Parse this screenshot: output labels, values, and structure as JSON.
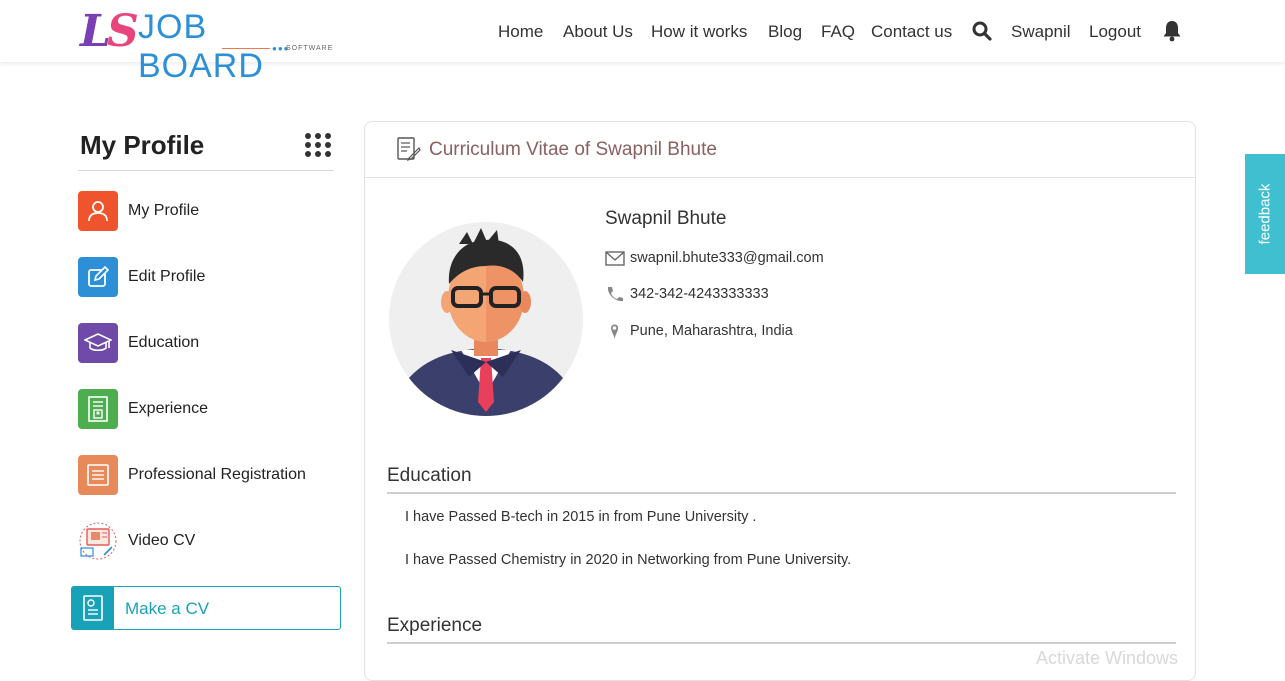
{
  "header": {
    "logo": {
      "ls": "LS",
      "text": "JOB BOARD",
      "sub": "SOFTWARE"
    },
    "nav": [
      "Home",
      "About Us",
      "How it works",
      "Blog",
      "FAQ",
      "Contact us"
    ],
    "user": "Swapnil",
    "logout": "Logout"
  },
  "sidebar": {
    "title": "My Profile",
    "items": [
      {
        "label": "My Profile",
        "icon": "user-icon",
        "color": "#f0542d"
      },
      {
        "label": "Edit Profile",
        "icon": "edit-icon",
        "color": "#2d8fd5"
      },
      {
        "label": "Education",
        "icon": "graduation-cap-icon",
        "color": "#6f4aa8"
      },
      {
        "label": "Experience",
        "icon": "document-badge-icon",
        "color": "#4cae4f"
      },
      {
        "label": "Professional Registration",
        "icon": "list-document-icon",
        "color": "#e8895a"
      },
      {
        "label": "Video CV",
        "icon": "video-cv-icon",
        "color": "#e55a5a"
      }
    ],
    "make_cv": "Make a CV"
  },
  "cv": {
    "title": "Curriculum Vitae of Swapnil Bhute",
    "name": "Swapnil Bhute",
    "email": "swapnil.bhute333@gmail.com",
    "phone": "342-342-4243333333",
    "location": "Pune, Maharashtra, India",
    "education_title": "Education",
    "education": [
      "I have Passed B-tech in 2015 in from Pune University .",
      "I have Passed Chemistry in 2020 in Networking from Pune University."
    ],
    "experience_title": "Experience"
  },
  "feedback": "feedback",
  "watermark": "Activate Windows"
}
